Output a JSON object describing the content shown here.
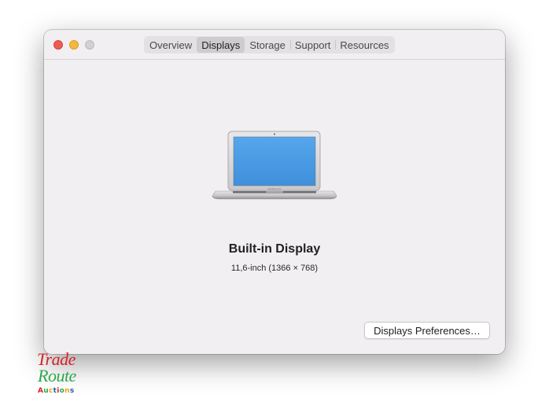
{
  "tabs": [
    {
      "label": "Overview",
      "active": false
    },
    {
      "label": "Displays",
      "active": true
    },
    {
      "label": "Storage",
      "active": false
    },
    {
      "label": "Support",
      "active": false
    },
    {
      "label": "Resources",
      "active": false
    }
  ],
  "display": {
    "name": "Built-in Display",
    "spec": "11,6-inch (1366 × 768)",
    "icon": "laptop-icon",
    "screen_color": "#4a9be2"
  },
  "buttons": {
    "preferences_label": "Displays Preferences…"
  },
  "watermark": {
    "line1": "Trade",
    "line2": "Route",
    "line3": "Auctions",
    "line3_colors": [
      "#d2232a",
      "#2aa84a",
      "#f0a020",
      "#1a5fb4",
      "#d2232a",
      "#2aa84a",
      "#f0a020",
      "#1a5fb4"
    ]
  },
  "colors": {
    "close": "#ee5b55",
    "minimize": "#f5b83c",
    "zoom_inactive": "#d3d0d3"
  }
}
